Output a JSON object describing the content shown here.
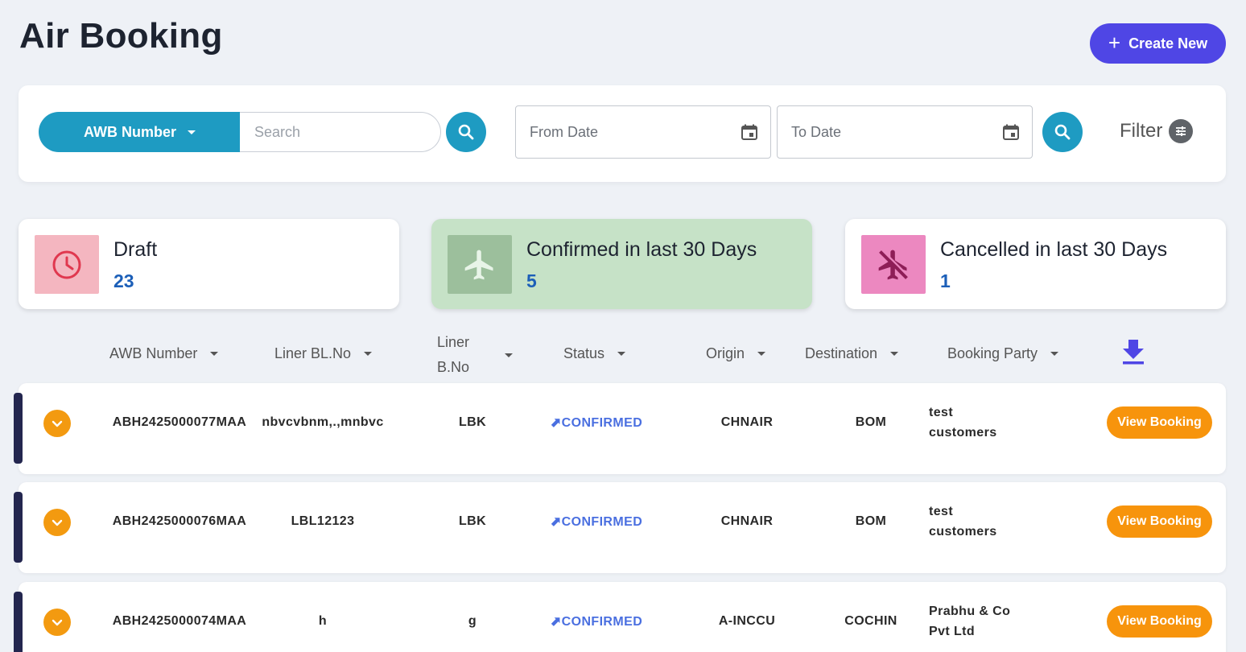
{
  "page": {
    "title": "Air Booking"
  },
  "toolbar": {
    "create_label": "Create New"
  },
  "search": {
    "field_label": "AWB Number",
    "placeholder": "Search",
    "from_date_placeholder": "From Date",
    "to_date_placeholder": "To Date",
    "filter_label": "Filter"
  },
  "stats": [
    {
      "label": "Draft",
      "count": "23",
      "icon": "clock-icon",
      "bg": "#ffffff",
      "icon_bg": "#f4b6c0"
    },
    {
      "label": "Confirmed in last 30 Days",
      "count": "5",
      "icon": "airplane-icon",
      "bg": "#c6e2c7",
      "icon_bg": "#9cbf9c"
    },
    {
      "label": "Cancelled in last 30 Days",
      "count": "1",
      "icon": "airplane-off-icon",
      "bg": "#ffffff",
      "icon_bg": "#ec88c0"
    }
  ],
  "table": {
    "columns": [
      "AWB Number",
      "Liner BL.No",
      "Liner B.No",
      "Status",
      "Origin",
      "Destination",
      "Booking Party"
    ],
    "download_icon": "download-icon",
    "view_label": "View Booking",
    "rows": [
      {
        "awb": "ABH2425000077MAA",
        "liner_bl": "nbvcvbnm,.,mnbvc",
        "liner_b": "LBK",
        "status": "CONFIRMED",
        "origin": "CHNAIR",
        "destination": "BOM",
        "party": "test customers"
      },
      {
        "awb": "ABH2425000076MAA",
        "liner_bl": "LBL12123",
        "liner_b": "LBK",
        "status": "CONFIRMED",
        "origin": "CHNAIR",
        "destination": "BOM",
        "party": "test customers"
      },
      {
        "awb": "ABH2425000074MAA",
        "liner_bl": "h",
        "liner_b": "g",
        "status": "CONFIRMED",
        "origin": "A-INCCU",
        "destination": "COCHIN",
        "party": "Prabhu & Co Pvt Ltd"
      }
    ]
  },
  "colors": {
    "accent": "#4f46e5",
    "primary": "#1e9bc2",
    "orange": "#f7940c",
    "status": "#4a6fe0",
    "row_bar": "#23264f"
  }
}
